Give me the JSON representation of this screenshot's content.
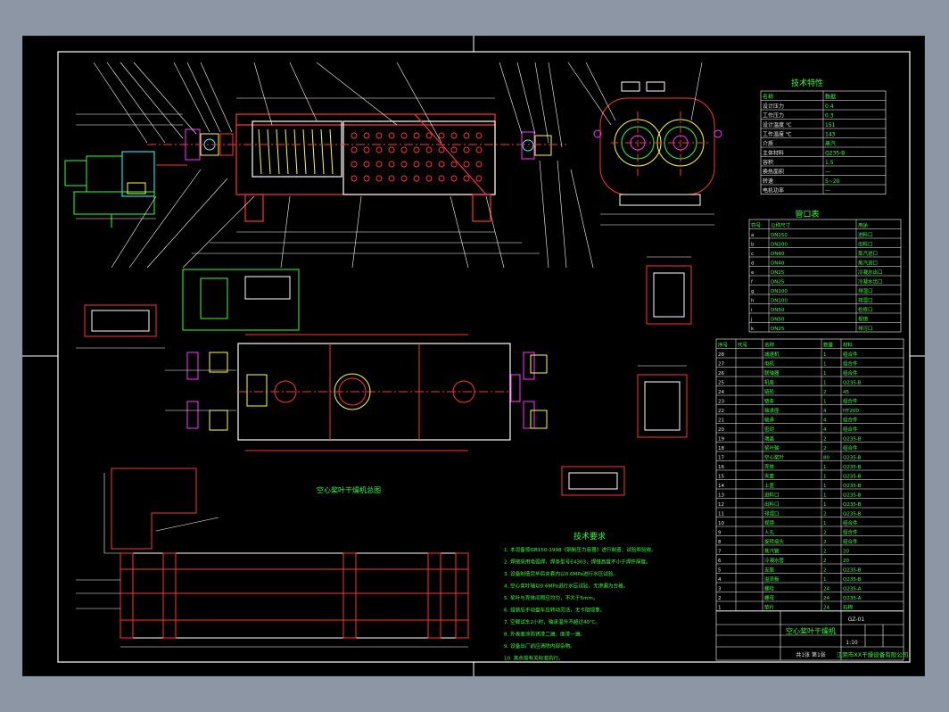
{
  "colors": {
    "background": "#000000",
    "frame": "#ffffff",
    "body": "#ff3333",
    "text_green": "#33ff33",
    "dim": "#ffffff",
    "centerline": "#ff3333",
    "accent_yellow": "#ffff33",
    "accent_magenta": "#ff33ff",
    "accent_cyan": "#33ffff",
    "accent_blue": "#3355ff"
  },
  "drawing": {
    "main_view_title": "空心桨叶干燥机",
    "section_title_1": "空心桨叶干燥机总图",
    "tech_spec_title": "技术特性",
    "nozzle_table_title": "管口表",
    "tech_requirements_title": "技术要求",
    "title_block_name": "空心桨叶干燥机",
    "company": "江阴市XX干燥设备有限公司"
  },
  "tech_spec": {
    "headers": [
      "名称",
      "数据"
    ],
    "rows": [
      [
        "设计压力",
        "0.4"
      ],
      [
        "工作压力",
        "0.3"
      ],
      [
        "设计温度 ℃",
        "151"
      ],
      [
        "工作温度 ℃",
        "143"
      ],
      [
        "介质",
        "蒸汽"
      ],
      [
        "主体材料",
        "Q235-B"
      ],
      [
        "容积",
        "1.5"
      ],
      [
        "换热面积",
        "—"
      ],
      [
        "转速",
        "5~20"
      ],
      [
        "电机功率",
        "—"
      ]
    ]
  },
  "nozzle_table": {
    "headers": [
      "符号",
      "公称尺寸",
      "用途"
    ],
    "rows": [
      [
        "a",
        "DN150",
        "进料口"
      ],
      [
        "b",
        "DN200",
        "出料口"
      ],
      [
        "c",
        "DN40",
        "蒸汽进口"
      ],
      [
        "d",
        "DN40",
        "蒸汽进口"
      ],
      [
        "e",
        "DN25",
        "冷凝水出口"
      ],
      [
        "f",
        "DN25",
        "冷凝水出口"
      ],
      [
        "g",
        "DN100",
        "排湿口"
      ],
      [
        "h",
        "DN100",
        "排湿口"
      ],
      [
        "i",
        "DN50",
        "检修口"
      ],
      [
        "j",
        "DN50",
        "视镜"
      ],
      [
        "k",
        "DN25",
        "排污口"
      ]
    ]
  },
  "parts_list": {
    "headers": [
      "序号",
      "代号",
      "名称",
      "数量",
      "材料"
    ],
    "rows": [
      [
        "28",
        "",
        "减速机",
        "1",
        "组合件"
      ],
      [
        "27",
        "",
        "电机",
        "1",
        "组合件"
      ],
      [
        "26",
        "",
        "联轴器",
        "1",
        "组合件"
      ],
      [
        "25",
        "",
        "机座",
        "1",
        "Q235-B"
      ],
      [
        "24",
        "",
        "链轮",
        "2",
        "45"
      ],
      [
        "23",
        "",
        "链条",
        "1",
        "组合件"
      ],
      [
        "22",
        "",
        "轴承座",
        "4",
        "HT200"
      ],
      [
        "21",
        "",
        "轴承",
        "4",
        "组合件"
      ],
      [
        "20",
        "",
        "密封",
        "4",
        "组合件"
      ],
      [
        "19",
        "",
        "端盖",
        "2",
        "Q235-B"
      ],
      [
        "18",
        "",
        "桨叶轴",
        "2",
        "组合件"
      ],
      [
        "17",
        "",
        "空心桨叶",
        "80",
        "Q235-B"
      ],
      [
        "16",
        "",
        "壳体",
        "1",
        "Q235-B"
      ],
      [
        "15",
        "",
        "夹套",
        "1",
        "Q235-B"
      ],
      [
        "14",
        "",
        "上盖",
        "1",
        "Q235-B"
      ],
      [
        "13",
        "",
        "进料口",
        "1",
        "Q235-B"
      ],
      [
        "12",
        "",
        "出料口",
        "1",
        "Q235-B"
      ],
      [
        "11",
        "",
        "排湿口",
        "2",
        "Q235-B"
      ],
      [
        "10",
        "",
        "视镜",
        "1",
        "组合件"
      ],
      [
        "9",
        "",
        "人孔",
        "2",
        "组合件"
      ],
      [
        "8",
        "",
        "旋转接头",
        "2",
        "组合件"
      ],
      [
        "7",
        "",
        "蒸汽管",
        "2",
        "20"
      ],
      [
        "6",
        "",
        "冷凝水管",
        "2",
        "20"
      ],
      [
        "5",
        "",
        "支座",
        "2",
        "Q235-B"
      ],
      [
        "4",
        "",
        "溢流板",
        "1",
        "Q235-B"
      ],
      [
        "3",
        "",
        "螺栓",
        "24",
        "Q235-A"
      ],
      [
        "2",
        "",
        "螺母",
        "24",
        "Q235-A"
      ],
      [
        "1",
        "",
        "垫片",
        "24",
        "石棉"
      ]
    ]
  },
  "tech_requirements": [
    "1. 本设备按GB150-1998《钢制压力容器》进行制造、试验和验收。",
    "2. 焊接采用电弧焊，焊条型号E4303，焊缝高度不小于焊件厚度。",
    "3. 设备制造完毕后夹套内以0.6MPa进行水压试验。",
    "4. 空心桨叶轴以0.6MPa进行水压试验，无渗漏为合格。",
    "5. 桨叶与壳体间隙应均匀，不大于5mm。",
    "6. 组装后手动盘车应转动灵活，无卡阻现象。",
    "7. 空载试车2小时，轴承温升不超过40℃。",
    "8. 外表面涂防锈漆二遍，面漆一遍。",
    "9. 设备出厂前应清除内部杂物。",
    "10. 其余按有关标准执行。"
  ],
  "title_block": {
    "scale": "1:10",
    "sheet": "共1张 第1张",
    "drawing_no": "GZ-01",
    "weight": "5000"
  }
}
